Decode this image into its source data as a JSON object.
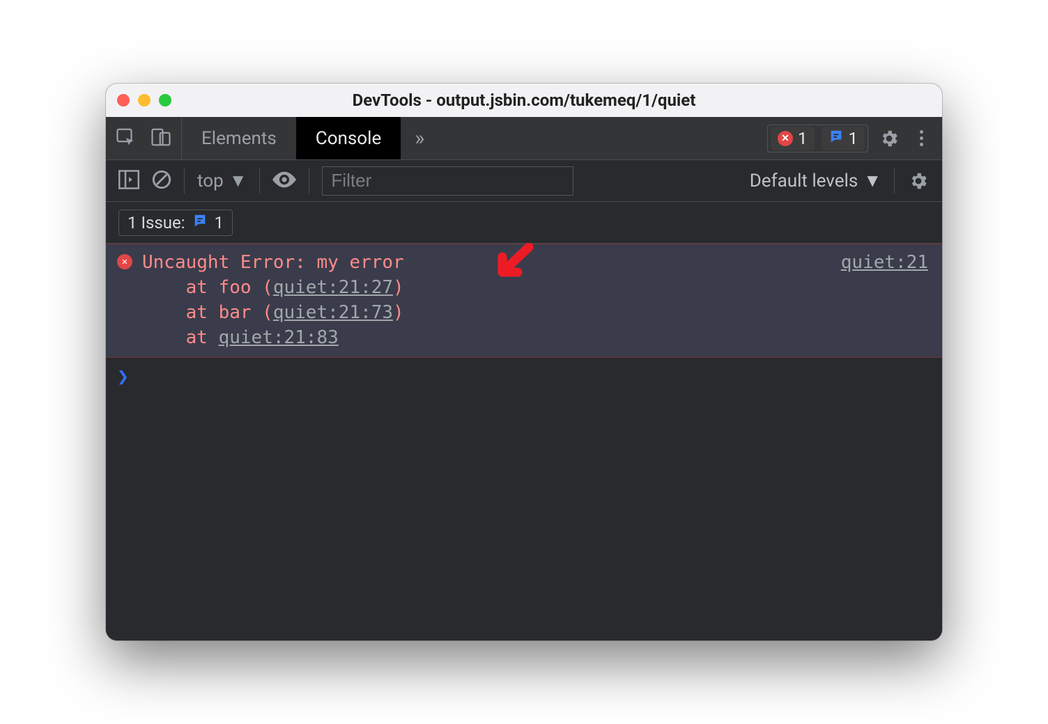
{
  "window": {
    "title": "DevTools - output.jsbin.com/tukemeq/1/quiet"
  },
  "tabs": {
    "elements": "Elements",
    "console": "Console"
  },
  "badges": {
    "error_count": "1",
    "issue_count": "1"
  },
  "sub": {
    "context": "top",
    "filter_placeholder": "Filter",
    "levels": "Default levels"
  },
  "issues_bar": {
    "label": "1 Issue:",
    "count": "1"
  },
  "error": {
    "message": "Uncaught Error: my error",
    "source": "quiet:21",
    "stack": [
      {
        "prefix": "    at foo (",
        "link": "quiet:21:27",
        "suffix": ")"
      },
      {
        "prefix": "    at bar (",
        "link": "quiet:21:73",
        "suffix": ")"
      },
      {
        "prefix": "    at ",
        "link": "quiet:21:83",
        "suffix": ""
      }
    ]
  },
  "prompt": {
    "symbol": "❯"
  }
}
